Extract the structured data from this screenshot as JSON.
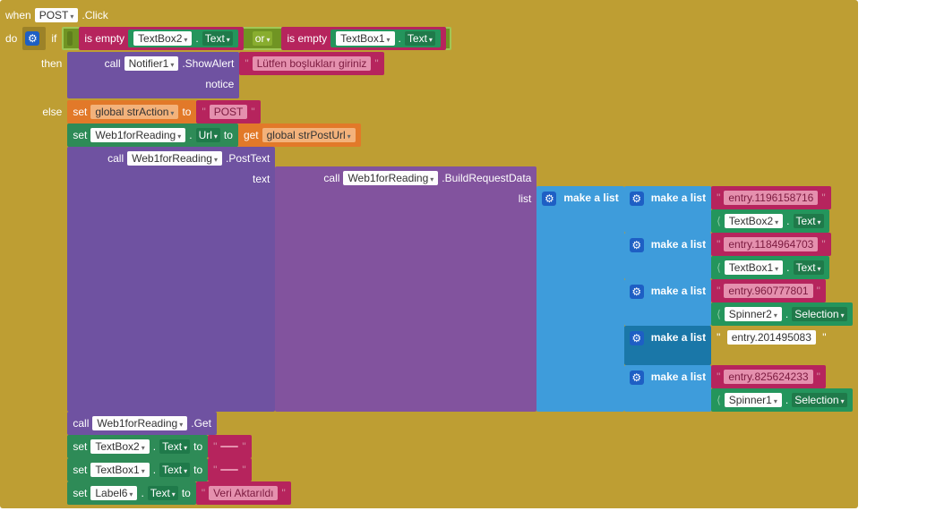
{
  "when": {
    "word_when": "when",
    "component": "POST",
    "event": ".Click",
    "word_do": "do"
  },
  "if_block": {
    "word_if": "if",
    "word_then": "then",
    "word_else": "else",
    "cond_left": {
      "is_empty": "is empty",
      "comp": "TextBox2",
      "dot": ".",
      "prop": "Text"
    },
    "or": "or",
    "cond_right": {
      "is_empty": "is empty",
      "comp": "TextBox1",
      "dot": ".",
      "prop": "Text"
    }
  },
  "then_call": {
    "word_call": "call",
    "comp": "Notifier1",
    "method": ".ShowAlert",
    "arg_label": "notice",
    "arg_value": "Lütfen boşlukları giriniz"
  },
  "else_steps": {
    "set_strAction": {
      "word_set": "set",
      "scope": "global strAction",
      "word_to": "to",
      "value": "POST"
    },
    "set_url": {
      "word_set": "set",
      "comp": "Web1forReading",
      "dot": ".",
      "prop": "Url",
      "word_to": "to",
      "word_get": "get",
      "var": "global strPostUrl"
    },
    "call_posttext": {
      "word_call": "call",
      "comp": "Web1forReading",
      "method": ".PostText",
      "arg_label": "text",
      "inner_call": {
        "word_call": "call",
        "comp": "Web1forReading",
        "method": ".BuildRequestData",
        "arg_label": "list",
        "make_a_list": "make a list",
        "sublists": [
          {
            "entry": "entry.1196158716",
            "comp": "TextBox2",
            "dot": ".",
            "prop": "Text"
          },
          {
            "entry": "entry.1184964703",
            "comp": "TextBox1",
            "dot": ".",
            "prop": "Text"
          },
          {
            "entry": "entry.960777801",
            "comp": "Spinner2",
            "dot": ".",
            "prop": "Selection"
          },
          {
            "entry": "entry.201495083"
          },
          {
            "entry": "entry.825624233",
            "comp": "Spinner1",
            "dot": ".",
            "prop": "Selection"
          }
        ]
      }
    },
    "call_get": {
      "word_call": "call",
      "comp": "Web1forReading",
      "method": ".Get"
    },
    "clear_tb2": {
      "word_set": "set",
      "comp": "TextBox2",
      "dot": ".",
      "prop": "Text",
      "word_to": "to",
      "value": ""
    },
    "clear_tb1": {
      "word_set": "set",
      "comp": "TextBox1",
      "dot": ".",
      "prop": "Text",
      "word_to": "to",
      "value": ""
    },
    "set_label6": {
      "word_set": "set",
      "comp": "Label6",
      "dot": ".",
      "prop": "Text",
      "word_to": "to",
      "value": "Veri Aktarıldı"
    }
  }
}
